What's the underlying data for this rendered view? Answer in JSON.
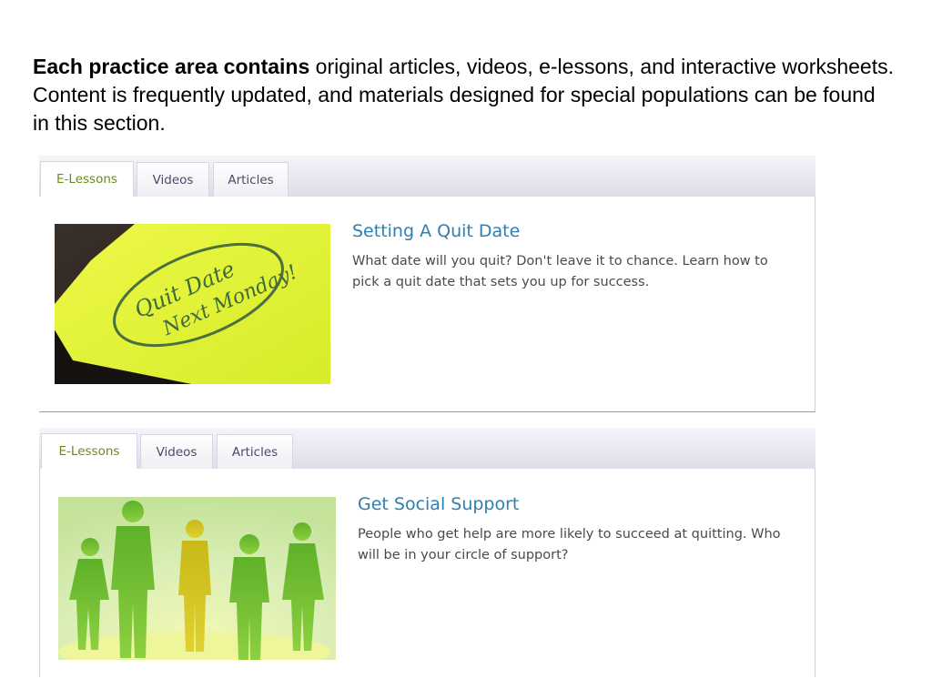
{
  "intro": {
    "bold": "Each practice area contains",
    "rest": " original articles, videos, e-lessons, and interactive worksheets.  Content is frequently updated, and materials designed for special populations can be found in this section."
  },
  "panels": [
    {
      "tabs": [
        "E-Lessons",
        "Videos",
        "Articles"
      ],
      "active_tab": "E-Lessons",
      "title": "Setting A Quit Date",
      "description": "What date will you quit? Don't leave it to chance. Learn how to pick a quit date that sets you up for success.",
      "image": {
        "note_line1": "Quit Date",
        "note_line2": "Next Monday!",
        "colors": {
          "note": "#e6f53a",
          "background": "#2a2520",
          "ink": "#3f6b3a"
        }
      }
    },
    {
      "tabs": [
        "E-Lessons",
        "Videos",
        "Articles"
      ],
      "active_tab": "E-Lessons",
      "title": "Get Social Support",
      "description": "People who get help are more likely to succeed at quitting. Who will be in your circle of support?",
      "image": {
        "colors": {
          "figures": "#6cb82a",
          "highlight": "#d8c81a",
          "background": "#dff0c0"
        }
      }
    }
  ]
}
